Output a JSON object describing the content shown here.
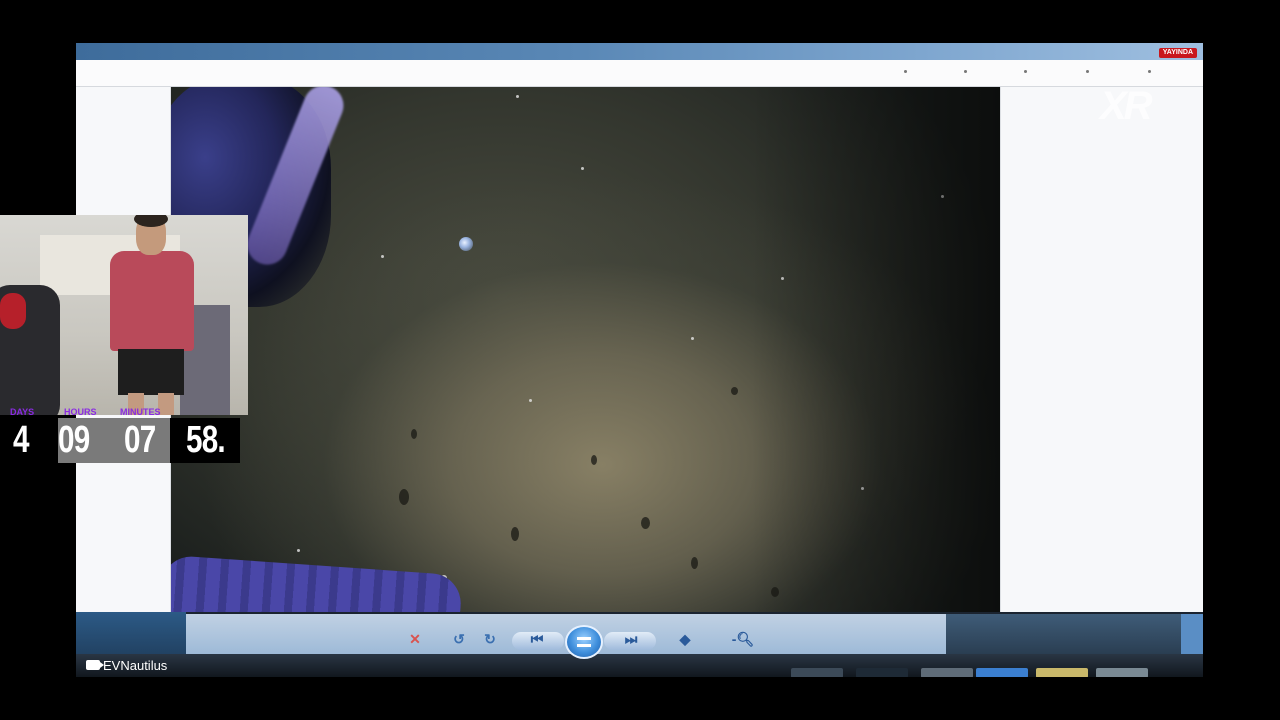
{
  "window": {
    "live_badge": "YAYINDA"
  },
  "watermark": {
    "logo_text": "XR"
  },
  "countdown": {
    "labels": {
      "days": "DAYS",
      "hours": "HOURS",
      "minutes": "MINUTES"
    },
    "values": {
      "days": "4",
      "hours": "09",
      "minutes": "07",
      "seconds": "58."
    },
    "label_color": "#8a2be2"
  },
  "player": {
    "controls": {
      "stop_icon": "stop-icon",
      "undo_icon": "rotate-left-icon",
      "redo_icon": "rotate-right-icon",
      "prev_icon": "skip-previous-icon",
      "play_icon": "play-pause-icon",
      "next_icon": "skip-next-icon",
      "fit_icon": "fit-diamond-icon",
      "zoom_icon": "zoom-out-icon"
    }
  },
  "brand": {
    "name": "EVNautilus"
  },
  "colors": {
    "live_badge": "#c9171d",
    "titlebar": "#3e6c9b",
    "hose": "#4a47a8"
  }
}
